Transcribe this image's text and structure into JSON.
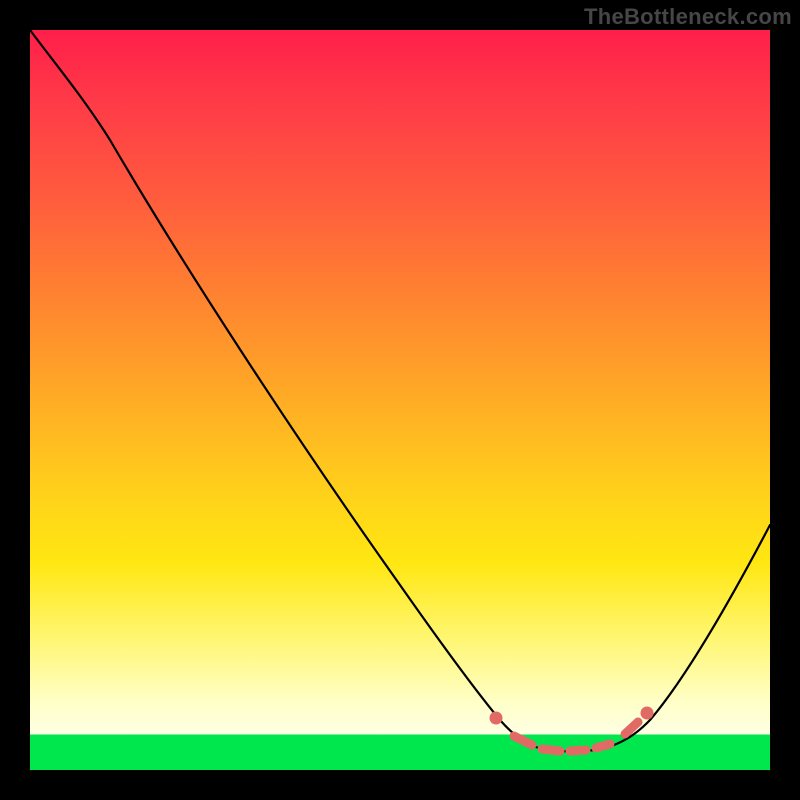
{
  "watermark": "TheBottleneck.com",
  "colors": {
    "frame": "#000000",
    "gradient_top": "#ff1f4a",
    "gradient_mid": "#ffe712",
    "gradient_bottom": "#00e64d",
    "curve": "#000000",
    "markers": "#e26a65"
  },
  "chart_data": {
    "type": "line",
    "title": "",
    "xlabel": "",
    "ylabel": "",
    "xlim": [
      0,
      100
    ],
    "ylim": [
      0,
      100
    ],
    "grid": false,
    "legend": "none",
    "series": [
      {
        "name": "bottleneck-curve",
        "x": [
          0,
          5,
          10,
          15,
          20,
          25,
          30,
          35,
          40,
          45,
          50,
          55,
          60,
          62,
          65,
          68,
          72,
          76,
          80,
          84,
          88,
          92,
          96,
          100
        ],
        "y": [
          100,
          95,
          89,
          82,
          75,
          68,
          61,
          54,
          47,
          40,
          33,
          26,
          18,
          13,
          8,
          5,
          4,
          4,
          4,
          5,
          9,
          16,
          26,
          38
        ]
      }
    ],
    "markers": {
      "name": "highlight-dots",
      "points": [
        {
          "x": 62,
          "y": 6
        },
        {
          "x": 65,
          "y": 5
        },
        {
          "x": 68,
          "y": 4
        },
        {
          "x": 71,
          "y": 4
        },
        {
          "x": 74,
          "y": 4
        },
        {
          "x": 77,
          "y": 4
        },
        {
          "x": 80,
          "y": 5
        },
        {
          "x": 83,
          "y": 6
        }
      ]
    }
  }
}
